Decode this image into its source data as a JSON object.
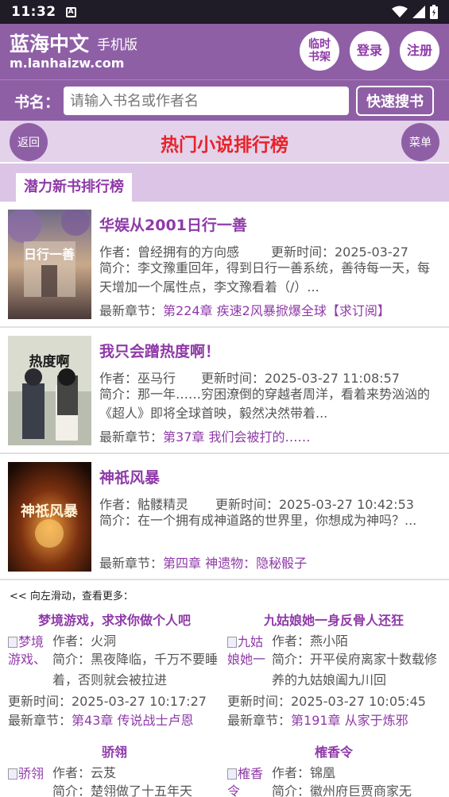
{
  "status_bar": {
    "time": "11:32"
  },
  "header": {
    "site_name": "蓝海中文",
    "site_sub": "手机版",
    "site_url": "m.lanhaizw.com",
    "buttons": {
      "shelf": "临时\n书架",
      "login": "登录",
      "register": "注册"
    }
  },
  "search": {
    "label": "书名：",
    "placeholder": "请输入书名或作者名",
    "button": "快速搜书"
  },
  "title_bar": {
    "back": "返回",
    "title": "热门小说排行榜",
    "menu": "菜单"
  },
  "section": {
    "tab": "潜力新书排行榜"
  },
  "books": [
    {
      "title": "华娱从2001日行一善",
      "author": "作者：曾经拥有的方向感",
      "updated": "更新时间：2025-03-27",
      "intro": "简介：李文豫重回年，得到日行一善系统，善待每一天，每天增加一个属性点，李文豫看着（/）...",
      "latest_label": "最新章节：",
      "latest": "第224章 疾速2风暴掀爆全球【求订阅】",
      "cover_text": "日行一善"
    },
    {
      "title": "我只会蹭热度啊！",
      "author": "作者：巫马行",
      "updated": "更新时间：2025-03-27 11:08:57",
      "intro": "简介：那一年……穷困潦倒的穿越者周洋，看着来势汹汹的《超人》即将全球首映，毅然决然带着...",
      "latest_label": "最新章节：",
      "latest": "第37章 我们会被打的……",
      "cover_text": "热度啊"
    },
    {
      "title": "神祇风暴",
      "author": "作者：骷髅精灵",
      "updated": "更新时间：2025-03-27 10:42:53",
      "intro": "简介：在一个拥有成神道路的世界里，你想成为神吗？...",
      "latest_label": "最新章节：",
      "latest": "第四章 神遗物：隐秘骰子",
      "cover_text": "神祇风暴"
    }
  ],
  "swipe_hint": "<< 向左滑动，查看更多：",
  "grid": [
    {
      "title": "梦境游戏，求求你做个人吧",
      "cover_alt": "梦境游戏、",
      "author": "作者：火洞",
      "intro": "简介：黑夜降临，千万不要睡着，否则就会被拉进",
      "updated": "更新时间：2025-03-27 10:17:27",
      "latest_label": "最新章节：",
      "latest": "第43章 传说战士卢恩"
    },
    {
      "title": "九姑娘她一身反骨人还狂",
      "cover_alt": "九姑娘她一",
      "author": "作者：燕小陌",
      "intro": "简介：开平侯府离家十数载修养的九姑娘阖九川回",
      "updated": "更新时间：2025-03-27 10:05:45",
      "latest_label": "最新章节：",
      "latest": "第191章 从家于炼邪"
    },
    {
      "title": "骄翎",
      "cover_alt": "骄翎",
      "author": "作者：云芨",
      "intro": "简介：楚翎做了十五年天",
      "updated": "",
      "latest_label": "",
      "latest": ""
    },
    {
      "title": "榷香令",
      "cover_alt": "榷香令",
      "author": "作者：锦凰",
      "intro": "简介：徽州府巨贾商家无",
      "updated": "",
      "latest_label": "",
      "latest": ""
    }
  ]
}
